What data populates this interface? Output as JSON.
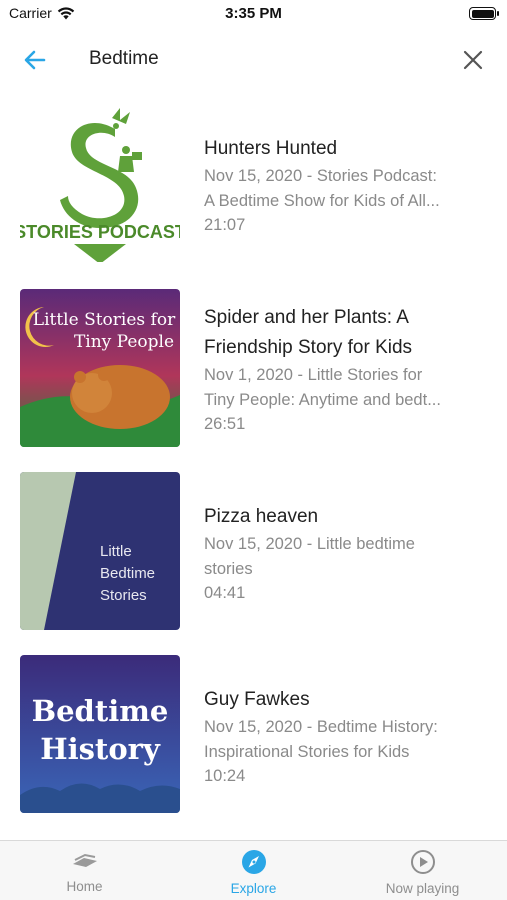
{
  "status_bar": {
    "carrier": "Carrier",
    "time": "3:35 PM",
    "battery_level": 1.0
  },
  "nav": {
    "title": "Bedtime",
    "back_icon": "arrow-left-icon",
    "close_icon": "close-icon",
    "accent_color": "#2aa6e6"
  },
  "episodes": [
    {
      "title": "Hunters Hunted",
      "subtitle": "Nov 15, 2020 - Stories Podcast: A Bedtime Show for Kids of All...",
      "subtitle_line1": "Nov 15, 2020 - Stories Podcast:",
      "subtitle_line2": "A Bedtime Show for Kids of All...",
      "duration": "21:07",
      "art": {
        "logo_text": "STORIES PODCAST"
      }
    },
    {
      "title": "Spider and her Plants: A Friendship Story for Kids",
      "title_line1": "Spider and her Plants: A",
      "title_line2": "Friendship Story for Kids",
      "subtitle": "Nov 1, 2020 - Little Stories for Tiny People: Anytime and bedt...",
      "subtitle_line1": "Nov 1, 2020 - Little Stories for",
      "subtitle_line2": "Tiny People: Anytime and bedt...",
      "duration": "26:51",
      "art": {
        "text_line1": "Little Stories for",
        "text_line2": "Tiny People"
      }
    },
    {
      "title": "Pizza heaven",
      "subtitle": "Nov 15, 2020 - Little bedtime stories",
      "subtitle_line1": "Nov 15, 2020 - Little bedtime",
      "subtitle_line2": "stories",
      "duration": "04:41",
      "art": {
        "text_line1": "Little",
        "text_line2": "Bedtime",
        "text_line3": "Stories"
      }
    },
    {
      "title": "Guy Fawkes",
      "subtitle": "Nov 15, 2020 - Bedtime History: Inspirational Stories for Kids",
      "subtitle_line1": "Nov 15, 2020 - Bedtime History:",
      "subtitle_line2": "Inspirational Stories for Kids",
      "duration": "10:24",
      "art": {
        "text_line1": "Bedtime",
        "text_line2": "History"
      }
    }
  ],
  "tabs": [
    {
      "label": "Home",
      "icon": "home-icon",
      "active": false
    },
    {
      "label": "Explore",
      "icon": "compass-icon",
      "active": true
    },
    {
      "label": "Now playing",
      "icon": "play-circle-icon",
      "active": false
    }
  ]
}
